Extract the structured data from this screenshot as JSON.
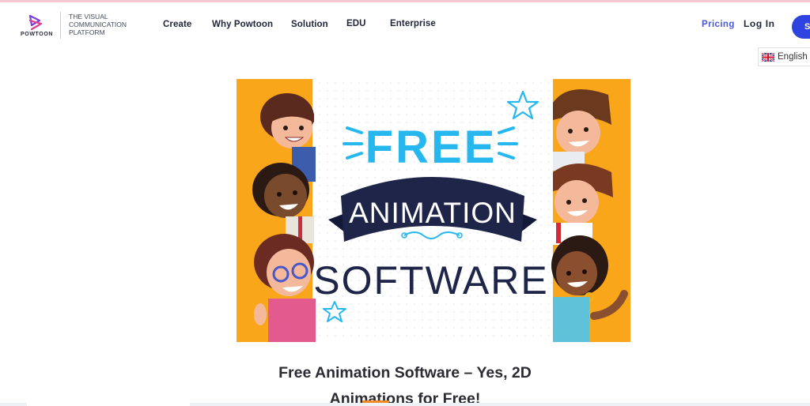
{
  "brand": {
    "logo_word": "POWTOON",
    "tagline": [
      "THE VISUAL",
      "COMMUNICATION",
      "PLATFORM"
    ]
  },
  "nav": {
    "items": [
      "Create",
      "Why Powtoon",
      "Solution",
      "EDU",
      "Enterprise"
    ],
    "pricing": "Pricing",
    "login": "Log In",
    "signup": "Sign Up"
  },
  "language": {
    "selected": "English"
  },
  "hero": {
    "word_free": "FREE",
    "word_animation": "ANIMATION",
    "word_software": "SOFTWARE"
  },
  "headline": {
    "line1": "Free Animation Software – Yes, 2D",
    "line2": "Animations for Free!"
  },
  "colors": {
    "accent_blue": "#2f43e0",
    "pricing_blue": "#4a56d6",
    "hero_orange": "#f9a61a",
    "banner_navy": "#1e2548",
    "free_cyan": "#27b7ef"
  }
}
